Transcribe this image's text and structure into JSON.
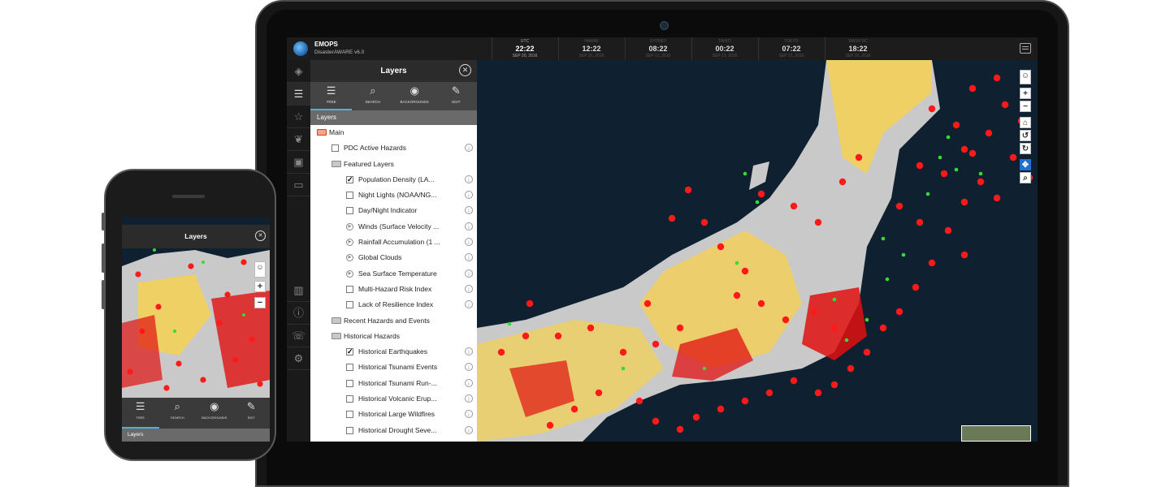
{
  "app": {
    "name": "EMOPS",
    "subtitle": "DisasterAWARE v6.0"
  },
  "clocks": [
    {
      "label": "UTC",
      "time": "22:22",
      "date": "SEP 20, 2016",
      "dim": false
    },
    {
      "label": "HAWAII",
      "time": "12:22",
      "date": "SEP 20, 2016",
      "dim": true
    },
    {
      "label": "SYDNEY",
      "time": "08:22",
      "date": "SEP 21, 2016",
      "dim": true
    },
    {
      "label": "TAHITI",
      "time": "00:22",
      "date": "SEP 21, 2016",
      "dim": true
    },
    {
      "label": "TOKYO",
      "time": "07:22",
      "date": "SEP 21, 2016",
      "dim": true
    },
    {
      "label": "WASH DC",
      "time": "18:22",
      "date": "SEP 20, 2016",
      "dim": true
    }
  ],
  "rail": [
    "hazards-icon",
    "layers-icon",
    "star-icon",
    "twitter-icon",
    "tv-icon",
    "video-icon",
    "chart-icon",
    "info-icon",
    "phone-icon",
    "network-icon"
  ],
  "panel": {
    "title": "Layers",
    "close": "✕",
    "tabs": [
      {
        "label": "TREE",
        "icon": "☰"
      },
      {
        "label": "SEARCH",
        "icon": "⌕"
      },
      {
        "label": "BACKGROUNDS",
        "icon": "◉"
      },
      {
        "label": "EDIT",
        "icon": "✎"
      }
    ],
    "section": "Layers",
    "tree": [
      {
        "type": "folder-open",
        "depth": 0,
        "label": "Main"
      },
      {
        "type": "checkbox",
        "depth": 1,
        "label": "PDC Active Hazards",
        "checked": false,
        "info": true
      },
      {
        "type": "folder",
        "depth": 1,
        "label": "Featured Layers"
      },
      {
        "type": "checkbox",
        "depth": 2,
        "label": "Population Density (LA...",
        "checked": true,
        "info": true
      },
      {
        "type": "checkbox",
        "depth": 2,
        "label": "Night Lights (NOAA/NG...",
        "checked": false,
        "info": true
      },
      {
        "type": "checkbox",
        "depth": 2,
        "label": "Day/Night Indicator",
        "checked": false,
        "info": true
      },
      {
        "type": "play",
        "depth": 2,
        "label": "Winds (Surface Velocity ...",
        "info": true
      },
      {
        "type": "play",
        "depth": 2,
        "label": "Rainfall Accumulation (1 ...",
        "info": true
      },
      {
        "type": "play",
        "depth": 2,
        "label": "Global Clouds",
        "info": true
      },
      {
        "type": "play",
        "depth": 2,
        "label": "Sea Surface Temperature",
        "info": true
      },
      {
        "type": "checkbox",
        "depth": 2,
        "label": "Multi-Hazard Risk Index",
        "checked": false,
        "info": true
      },
      {
        "type": "checkbox",
        "depth": 2,
        "label": "Lack of Resilience Index",
        "checked": false,
        "info": true
      },
      {
        "type": "folder",
        "depth": 1,
        "label": "Recent Hazards and Events"
      },
      {
        "type": "folder",
        "depth": 1,
        "label": "Historical Hazards"
      },
      {
        "type": "checkbox",
        "depth": 2,
        "label": "Historical Earthquakes",
        "checked": true,
        "info": true
      },
      {
        "type": "checkbox",
        "depth": 2,
        "label": "Historical Tsunami Events",
        "checked": false,
        "info": true
      },
      {
        "type": "checkbox",
        "depth": 2,
        "label": "Historical Tsunami Run-...",
        "checked": false,
        "info": true
      },
      {
        "type": "checkbox",
        "depth": 2,
        "label": "Historical Volcanic Erup...",
        "checked": false,
        "info": true
      },
      {
        "type": "checkbox",
        "depth": 2,
        "label": "Historical Large Wildfires",
        "checked": false,
        "info": true
      },
      {
        "type": "checkbox",
        "depth": 2,
        "label": "Historical Drought Seve...",
        "checked": false,
        "info": true
      }
    ]
  },
  "map_controls": [
    "person-icon",
    "+",
    "−",
    "⌂",
    "↺",
    "↻",
    "✥",
    "⌕"
  ],
  "phone": {
    "title": "Layers",
    "close": "✕",
    "tabs": [
      {
        "label": "TREE",
        "icon": "☰"
      },
      {
        "label": "SEARCH",
        "icon": "⌕"
      },
      {
        "label": "BACKGROUNDS",
        "icon": "◉"
      },
      {
        "label": "EDIT",
        "icon": "✎"
      }
    ],
    "section": "Layers",
    "controls": [
      "person-icon",
      "+",
      "−"
    ]
  },
  "colors": {
    "quake": "#ff1a1a",
    "tsunami": "#33dd33",
    "land_low": "#c9c9c9",
    "pop_low": "#ffd33a",
    "pop_high": "#e01010",
    "sea": "#0f2030"
  }
}
